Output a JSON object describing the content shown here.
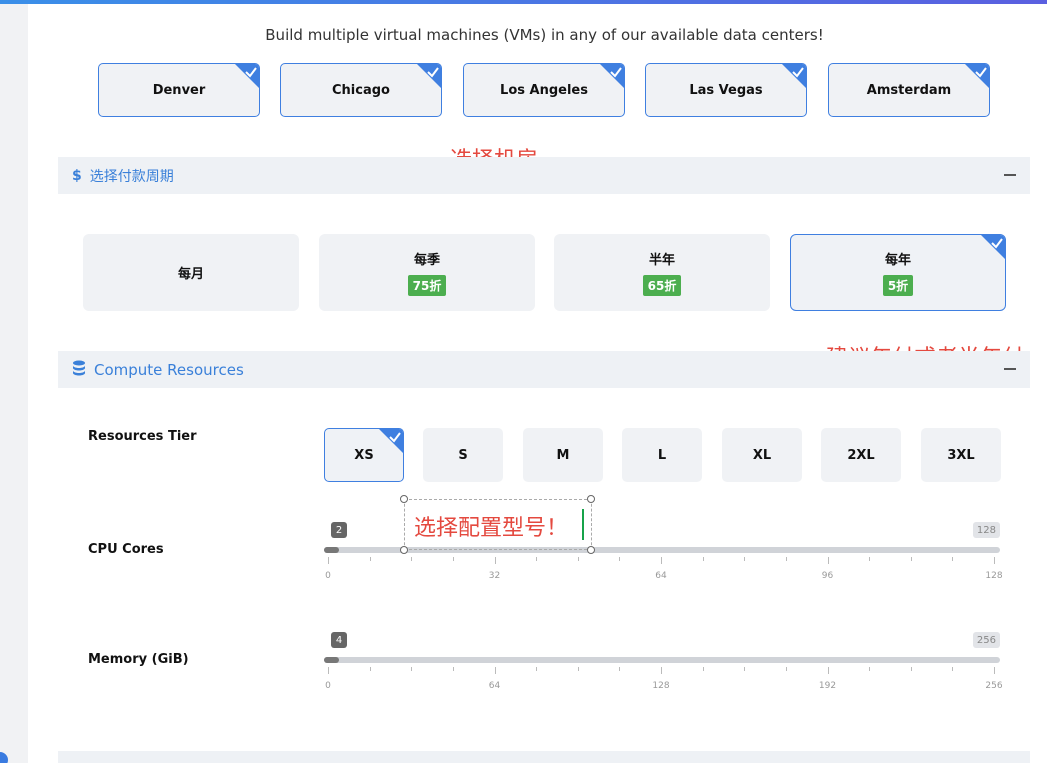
{
  "intro_text": "Build multiple virtual machines (VMs) in any of our available data centers!",
  "datacenters": [
    {
      "label": "Denver",
      "selected": true
    },
    {
      "label": "Chicago",
      "selected": true
    },
    {
      "label": "Los Angeles",
      "selected": true
    },
    {
      "label": "Las Vegas",
      "selected": true
    },
    {
      "label": "Amsterdam",
      "selected": true
    }
  ],
  "annotations": {
    "select_datacenter": "选择机房",
    "recommend_yearly": "建议年付或者半年付",
    "select_model": "选择配置型号！"
  },
  "billing": {
    "title": "选择付款周期",
    "options": [
      {
        "label": "每月",
        "badge": ""
      },
      {
        "label": "每季",
        "badge": "75折"
      },
      {
        "label": "半年",
        "badge": "65折"
      },
      {
        "label": "每年",
        "badge": "5折",
        "selected": true
      }
    ]
  },
  "compute": {
    "title": "Compute Resources",
    "tier_label": "Resources Tier",
    "tiers": [
      "XS",
      "S",
      "M",
      "L",
      "XL",
      "2XL",
      "3XL"
    ],
    "selected_tier": "XS",
    "cpu": {
      "label": "CPU Cores",
      "value": "2",
      "max": "128",
      "ticks": [
        "0",
        "32",
        "64",
        "96",
        "128"
      ]
    },
    "memory": {
      "label": "Memory (GiB)",
      "value": "4",
      "max": "256",
      "ticks": [
        "0",
        "64",
        "128",
        "192",
        "256"
      ]
    }
  },
  "colors": {
    "accent": "#3f7fe0",
    "badge_green": "#4cae4f",
    "annotation_red": "#e4493f"
  }
}
